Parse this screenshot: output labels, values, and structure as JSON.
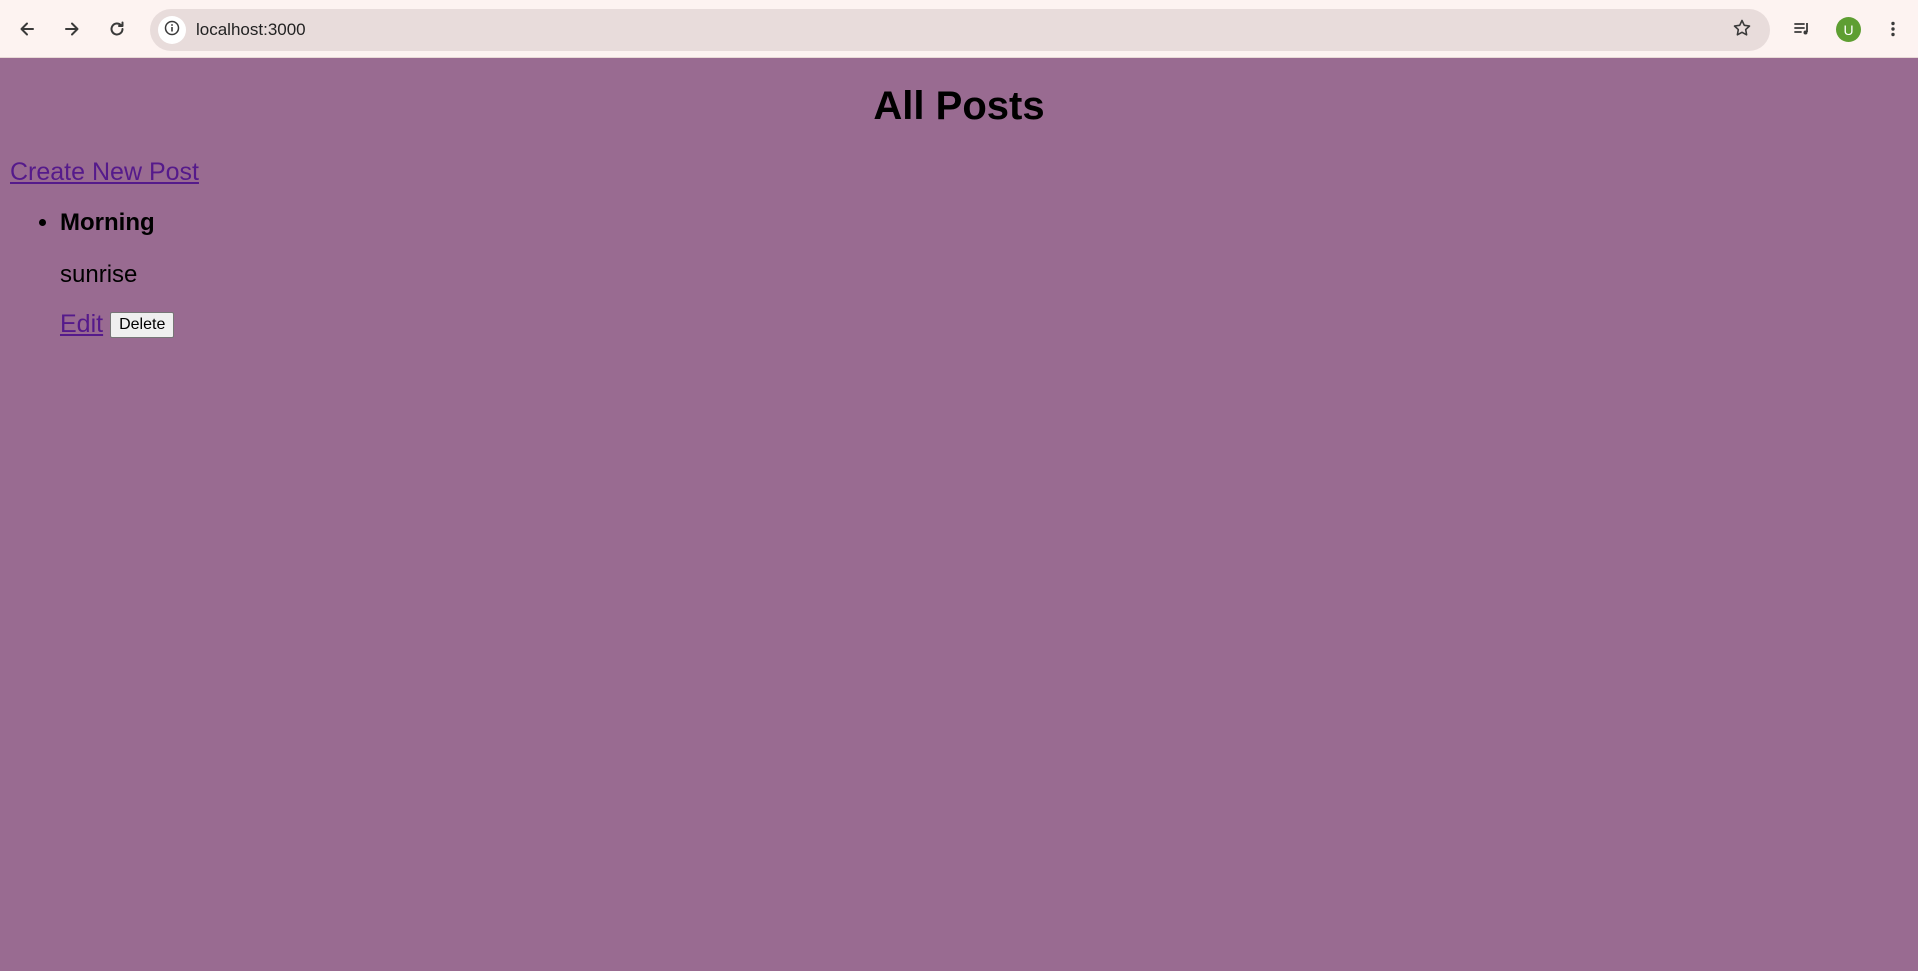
{
  "browser": {
    "url": "localhost:3000",
    "profile_initial": "U"
  },
  "page": {
    "title": "All Posts",
    "create_link_label": "Create New Post"
  },
  "posts": [
    {
      "title": "Morning",
      "content": "sunrise",
      "edit_label": "Edit",
      "delete_label": "Delete"
    }
  ],
  "colors": {
    "page_background": "#996b91",
    "link": "#551a8b",
    "avatar": "#5e9e32"
  },
  "icons": [
    "back-arrow-icon",
    "forward-arrow-icon",
    "reload-icon",
    "site-info-icon",
    "star-icon",
    "media-controls-icon",
    "more-menu-icon"
  ]
}
